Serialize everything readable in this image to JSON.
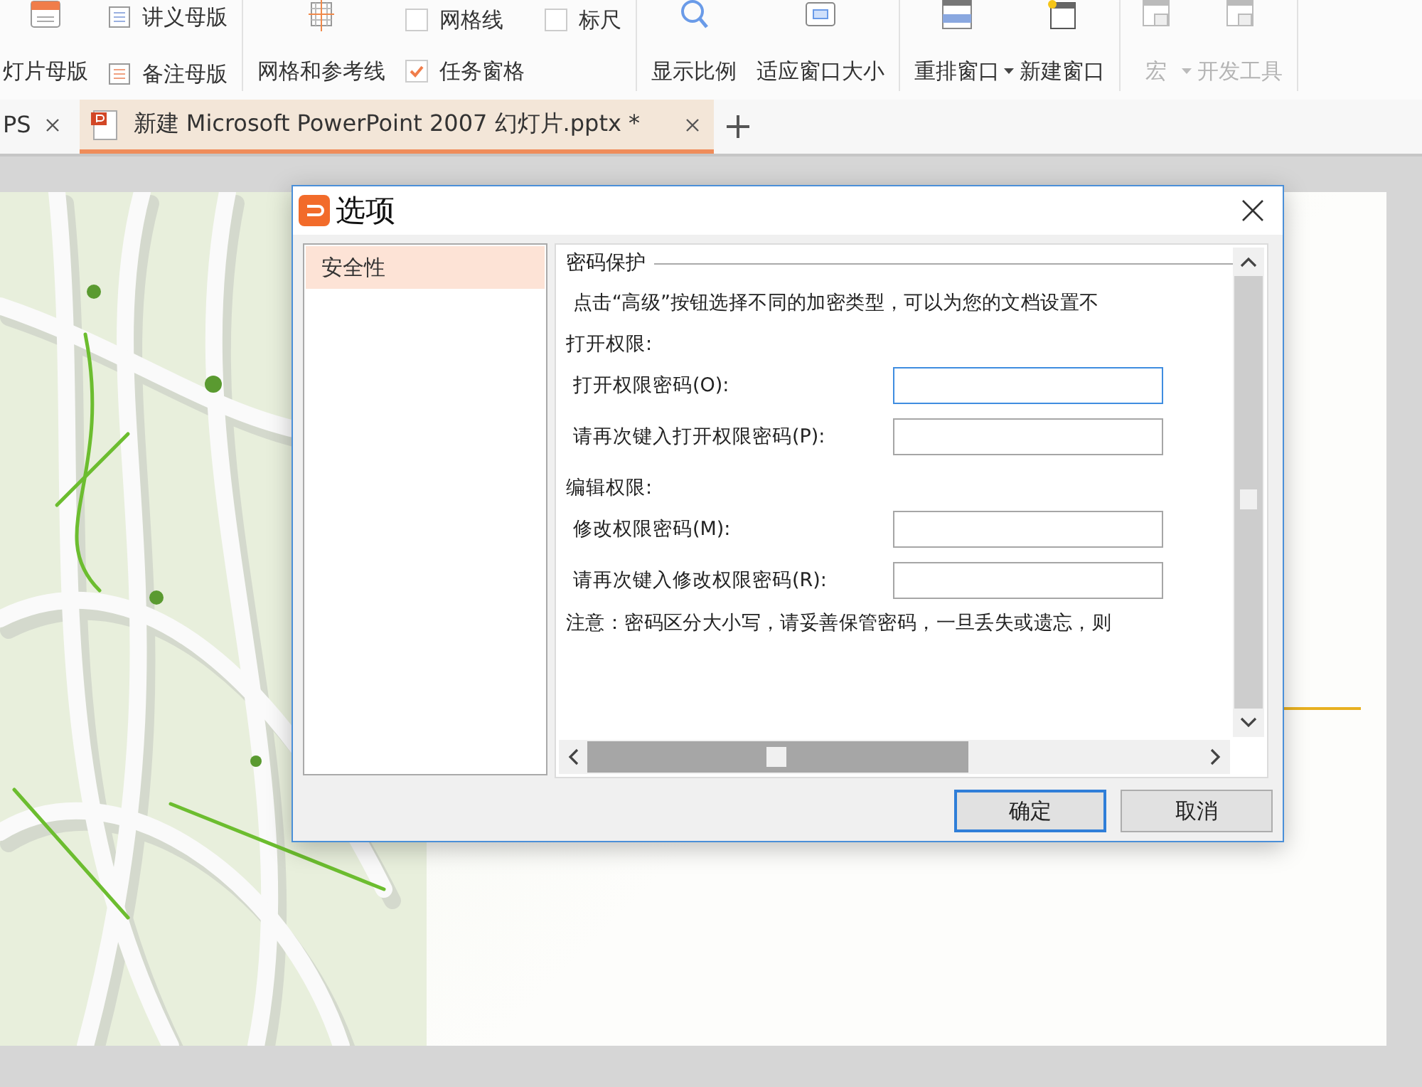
{
  "ribbon": {
    "groups": [
      {
        "columns": [
          {
            "kind": "large",
            "label": "灯片母版",
            "disabled": false
          },
          {
            "kind": "stack",
            "items": [
              {
                "kind": "small",
                "label": "讲义母版",
                "disabled": false
              },
              {
                "kind": "small",
                "label": "备注母版",
                "disabled": false
              }
            ]
          }
        ]
      },
      {
        "columns": [
          {
            "kind": "large",
            "label": "网格和参考线",
            "disabled": false
          },
          {
            "kind": "stack",
            "items": [
              {
                "kind": "checkbox",
                "label": "网格线",
                "checked": false
              },
              {
                "kind": "checkbox",
                "label": "任务窗格",
                "checked": true
              }
            ]
          },
          {
            "kind": "stack",
            "items": [
              {
                "kind": "checkbox",
                "label": "标尺",
                "checked": false
              }
            ]
          }
        ]
      },
      {
        "columns": [
          {
            "kind": "large",
            "label": "显示比例",
            "disabled": false
          },
          {
            "kind": "large",
            "label": "适应窗口大小",
            "disabled": false
          }
        ]
      },
      {
        "columns": [
          {
            "kind": "large",
            "label": "重排窗口",
            "dropdown": true,
            "disabled": false
          },
          {
            "kind": "large",
            "label": "新建窗口",
            "disabled": false
          }
        ]
      },
      {
        "columns": [
          {
            "kind": "large",
            "label": "宏",
            "dropdown": true,
            "disabled": true
          },
          {
            "kind": "large",
            "label": "开发工具",
            "disabled": true
          }
        ]
      }
    ]
  },
  "tabs": [
    {
      "label": "PS",
      "selected": false,
      "icon": false
    },
    {
      "label": "新建 Microsoft PowerPoint 2007 幻灯片.pptx *",
      "selected": true,
      "icon": true
    }
  ],
  "dialog": {
    "title": "选项",
    "nav": [
      {
        "label": "安全性",
        "selected": true
      }
    ],
    "section": "密码保护",
    "intro": "点击“高级”按钮选择不同的加密类型，可以为您的文档设置不",
    "groups": [
      {
        "label": "打开权限:",
        "fields": [
          {
            "label": "打开权限密码(O):",
            "focused": true
          },
          {
            "label": "请再次键入打开权限密码(P):",
            "focused": false
          }
        ]
      },
      {
        "label": "编辑权限:",
        "fields": [
          {
            "label": "修改权限密码(M):",
            "focused": false
          },
          {
            "label": "请再次键入修改权限密码(R):",
            "focused": false
          }
        ]
      }
    ],
    "note": "注意：密码区分大小写，请妥善保管密码，一旦丢失或遗忘，则",
    "buttons": [
      {
        "label": "确定",
        "default": true
      },
      {
        "label": "取消",
        "default": false
      }
    ]
  }
}
